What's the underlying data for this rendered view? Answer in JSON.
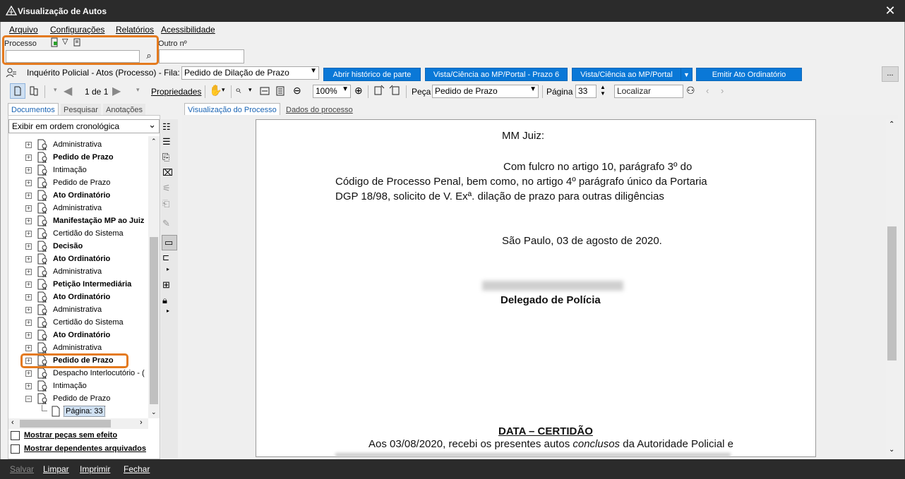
{
  "window": {
    "title": "Visualização de Autos",
    "close_symbol": "✕"
  },
  "menu": {
    "items": [
      "Arquivo",
      "Configurações",
      "Relatórios",
      "Acessibilidade"
    ]
  },
  "search": {
    "processo_label": "Processo",
    "outro_label": "Outro nº",
    "processo_value": "",
    "outro_value": ""
  },
  "info_bar": {
    "text": "Inquérito Policial - Atos (Processo) - Fila:",
    "fila_value": "Pedido de Dilação de Prazo",
    "buttons": [
      "Abrir histórico de parte",
      "Vista/Ciência ao MP/Portal - Prazo 6",
      "Vista/Ciência ao MP/Portal",
      "Emitir Ato Ordinatório"
    ],
    "more_label": "..."
  },
  "toolbar": {
    "page_counter": "1 de 1",
    "propriedades_label": "Propriedades",
    "zoom_value": "100%",
    "peca_label": "Peça",
    "peca_value": "Pedido de Prazo",
    "pagina_label": "Página",
    "pagina_value": "33",
    "localizar_placeholder": "Localizar"
  },
  "left_tabs": [
    "Documentos",
    "Pesquisar",
    "Anotações"
  ],
  "order_select": "Exibir em ordem cronológica",
  "tree": [
    {
      "label": "Administrativa",
      "bold": false
    },
    {
      "label": "Pedido de Prazo",
      "bold": true
    },
    {
      "label": "Intimação",
      "bold": false
    },
    {
      "label": "Pedido de Prazo",
      "bold": false
    },
    {
      "label": "Ato Ordinatório",
      "bold": true
    },
    {
      "label": "Administrativa",
      "bold": false
    },
    {
      "label": "Manifestação MP ao Juiz",
      "bold": true
    },
    {
      "label": "Certidão do Sistema",
      "bold": false
    },
    {
      "label": "Decisão",
      "bold": true
    },
    {
      "label": "Ato Ordinatório",
      "bold": true
    },
    {
      "label": "Administrativa",
      "bold": false
    },
    {
      "label": "Petição Intermediária",
      "bold": true
    },
    {
      "label": "Ato Ordinatório",
      "bold": true
    },
    {
      "label": "Administrativa",
      "bold": false
    },
    {
      "label": "Certidão do Sistema",
      "bold": false
    },
    {
      "label": "Ato Ordinatório",
      "bold": true
    },
    {
      "label": "Administrativa",
      "bold": false
    },
    {
      "label": "Pedido de Prazo",
      "bold": true
    },
    {
      "label": "Despacho Interlocutório - (",
      "bold": false
    },
    {
      "label": "Intimação",
      "bold": false
    },
    {
      "label": "Pedido de Prazo",
      "bold": false
    }
  ],
  "tree_child": "Página: 33",
  "checkboxes": [
    "Mostrar peças sem efeito",
    "Mostrar dependentes arquivados"
  ],
  "viewer_tabs": [
    "Visualização do Processo",
    "Dados do processo"
  ],
  "document": {
    "salutation": "MM Juiz:",
    "line1": "Com fulcro no artigo 10, parágrafo 3º do",
    "line2": "Código de Processo Penal, bem como, no artigo 4º parágrafo único da Portaria",
    "line3": "DGP 18/98, solicito de V. Exª. dilação de prazo para outras diligências",
    "date": "São Paulo, 03 de agosto de 2020.",
    "signature_title": "Delegado de Polícia",
    "cert_title": "DATA – CERTIDÃO",
    "cert_line1_a": "Aos 03/08/2020, recebi os presentes autos ",
    "cert_line1_b": "conclusos",
    "cert_line1_c": " da Autoridade Policial e"
  },
  "bottom_bar": [
    "Salvar",
    "Limpar",
    "Imprimir",
    "Fechar"
  ],
  "colors": {
    "accent_blue": "#0a78d7",
    "highlight_orange": "#e47a1e",
    "titlebar": "#2b2b2b"
  }
}
